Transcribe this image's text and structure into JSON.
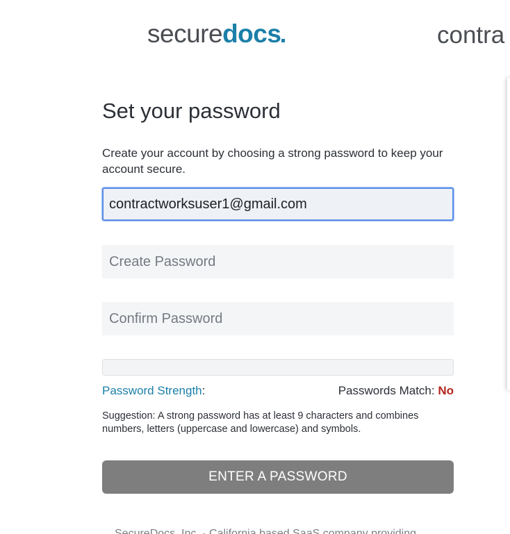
{
  "logos": {
    "securedocs_part1": "secure",
    "securedocs_part2": "docs",
    "contractworks_visible": "contra"
  },
  "form": {
    "title": "Set your password",
    "description": "Create your account by choosing a strong password to keep your account secure.",
    "email_value": "contractworksuser1@gmail.com",
    "create_password_placeholder": "Create Password",
    "confirm_password_placeholder": "Confirm Password",
    "strength_fraction": 0,
    "strength_link": "Password Strength",
    "strength_colon": ":",
    "match_label": "Passwords Match: ",
    "match_value": "No",
    "suggestion": "Suggestion: A strong password has at least 9 characters and combines numbers, letters (uppercase and lowercase) and symbols.",
    "submit_label": "ENTER A PASSWORD"
  },
  "footer": {
    "text": "SecureDocs, Inc. · California based SaaS company providing"
  },
  "colors": {
    "brand": "#1b7fa8",
    "match_no": "#b3261e",
    "button_disabled": "#7e7e7e",
    "focus_ring": "#5b8ee8"
  }
}
